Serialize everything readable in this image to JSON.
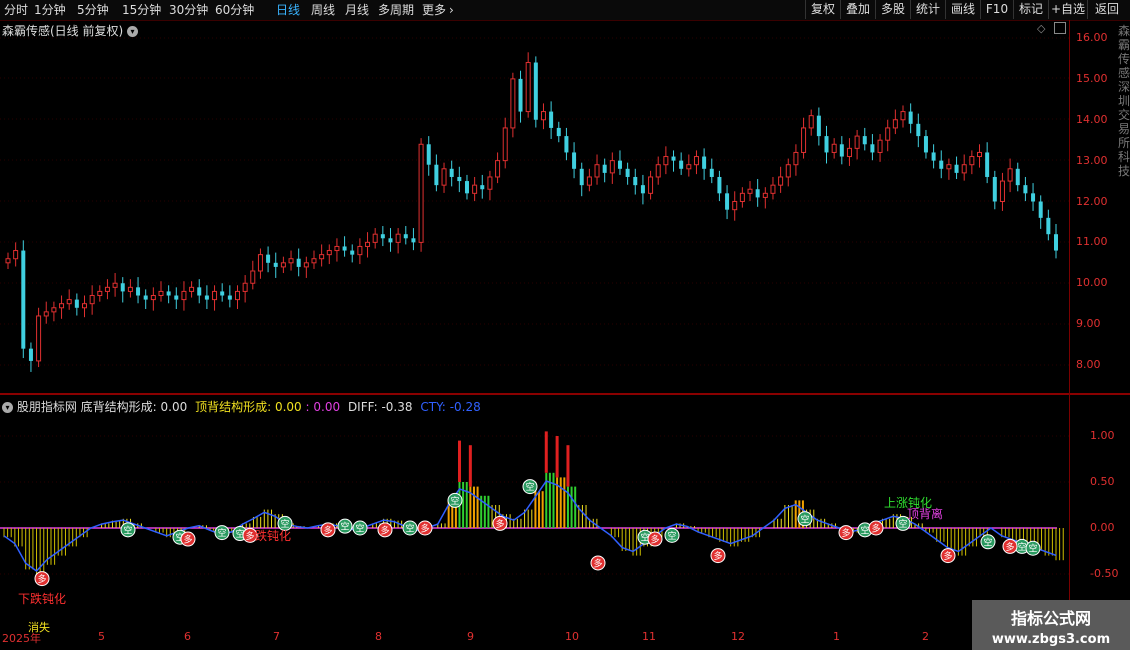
{
  "toolbar": {
    "periods": [
      "分时",
      "1分钟",
      "5分钟",
      "15分钟",
      "30分钟",
      "60分钟",
      "日线",
      "周线",
      "月线",
      "多周期",
      "更多"
    ],
    "active_period": "日线",
    "more_chevron": "›",
    "buttons": [
      "复权",
      "叠加",
      "多股",
      "统计",
      "画线",
      "F10",
      "标记",
      "+自选",
      "返回"
    ]
  },
  "main_chart": {
    "title": "森霸传感(日线 前复权)",
    "y_ticks": [
      "16.00",
      "15.00",
      "14.00",
      "13.00",
      "12.00",
      "11.00",
      "10.00",
      "9.00",
      "8.00"
    ],
    "y_range": [
      7.6,
      16.4
    ],
    "candles_up_color": "#e03030",
    "candles_down_color": "#40d0e0"
  },
  "sub_chart": {
    "name": "股朋指标网",
    "fields": [
      {
        "label": "底背结构形成:",
        "value": "0.00",
        "color": "#dddddd"
      },
      {
        "label": "顶背结构形成:",
        "value": "0.00",
        "color": "#f0e020"
      },
      {
        "label": ":",
        "value": "0.00",
        "color": "#e040e0"
      },
      {
        "label": "DIFF:",
        "value": "-0.38",
        "color": "#dddddd"
      },
      {
        "label": "CTY:",
        "value": "-0.28",
        "color": "#3060ff"
      }
    ],
    "y_ticks": [
      "1.00",
      "0.50",
      "0.00",
      "-0.50"
    ],
    "annotations": {
      "down_blunt": "下跌钝化",
      "up_blunt": "上涨钝化",
      "top_div": "顶背离",
      "disappear": "消失",
      "blunt_partial": "跌钝化"
    },
    "markers": {
      "kong": "空",
      "duo": "多"
    }
  },
  "date_axis": [
    "2025年",
    "5",
    "6",
    "7",
    "8",
    "9",
    "10",
    "11",
    "12",
    "1",
    "2"
  ],
  "right_panel_text": "森霸传感深圳交易所科技",
  "watermark": {
    "line1": "指标公式网",
    "line2": "www.zbgs3.com"
  }
}
